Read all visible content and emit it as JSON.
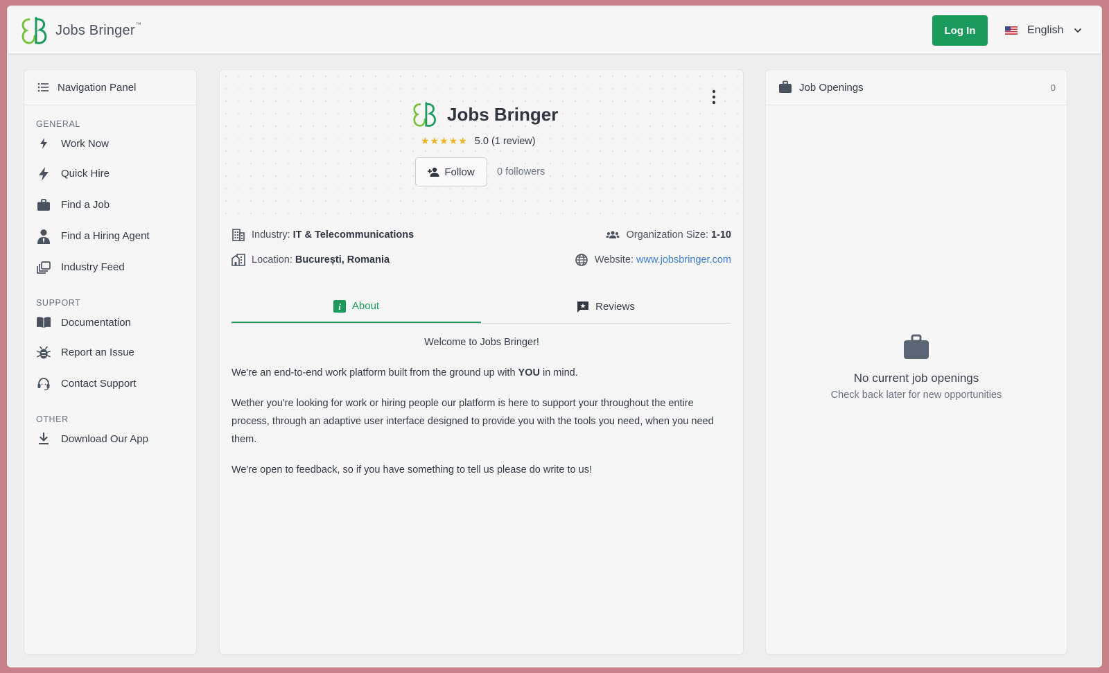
{
  "header": {
    "brand_name": "Jobs Bringer",
    "brand_tm": "™",
    "login_label": "Log In",
    "language": "English",
    "flag_icon": "us-flag-icon"
  },
  "nav": {
    "title": "Navigation Panel",
    "sections": [
      {
        "label": "GENERAL",
        "items": [
          {
            "label": "Work Now",
            "icon": "bolt-icon"
          },
          {
            "label": "Quick Hire",
            "icon": "lightning-icon"
          },
          {
            "label": "Find a Job",
            "icon": "briefcase-icon"
          },
          {
            "label": "Find a Hiring Agent",
            "icon": "agent-icon"
          },
          {
            "label": "Industry Feed",
            "icon": "feed-icon"
          }
        ]
      },
      {
        "label": "SUPPORT",
        "items": [
          {
            "label": "Documentation",
            "icon": "book-icon"
          },
          {
            "label": "Report an Issue",
            "icon": "bug-icon"
          },
          {
            "label": "Contact Support",
            "icon": "headset-icon"
          }
        ]
      },
      {
        "label": "OTHER",
        "items": [
          {
            "label": "Download Our App",
            "icon": "download-icon"
          }
        ]
      }
    ]
  },
  "company": {
    "name": "Jobs Bringer",
    "stars": "★★★★★",
    "rating": 5.0,
    "rating_text": "5.0 (1 review)",
    "follow_label": "Follow",
    "followers_text": "0 followers",
    "industry_label": "Industry:",
    "industry_value": "IT & Telecommunications",
    "org_size_label": "Organization Size:",
    "org_size_value": "1-10",
    "location_label": "Location:",
    "location_value": "București, Romania",
    "website_label": "Website:",
    "website_value": "www.jobsbringer.com"
  },
  "tabs": [
    {
      "label": "About",
      "active": true
    },
    {
      "label": "Reviews",
      "active": false
    }
  ],
  "about": {
    "welcome": "Welcome to Jobs Bringer!",
    "p1_before": "We're an end-to-end work platform built from the ground up with ",
    "p1_bold": "YOU",
    "p1_after": " in mind.",
    "p2": "Wether you're looking for work or hiring people our platform is here to support your throughout the entire process, through an adaptive user interface designed to provide you with the tools you need, when you need them.",
    "p3": "We're open to feedback, so if you have something to tell us please do write to us!"
  },
  "jobs": {
    "title": "Job Openings",
    "count": "0",
    "empty_title": "No current job openings",
    "empty_sub": "Check back later for new opportunities"
  },
  "colors": {
    "accent": "#1a9a5c",
    "link": "#3b7fd6",
    "star": "#f0b429",
    "frame_border": "#c98089"
  }
}
